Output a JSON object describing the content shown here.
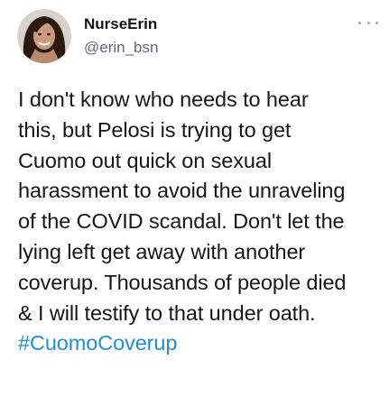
{
  "user": {
    "display_name": "NurseErin",
    "handle": "@erin_bsn"
  },
  "icons": {
    "more": "more-horizontal-icon"
  },
  "tweet": {
    "lines": [
      "I don't know who needs to hear",
      "this, but Pelosi is trying to get",
      "Cuomo out quick on sexual",
      "harassment to avoid the unraveling",
      "of the COVID scandal.  Don't let the",
      "lying left get away with another",
      "coverup. Thousands of people died",
      "& I will testify to that under oath."
    ],
    "hashtag": "#CuomoCoverup"
  },
  "colors": {
    "hashtag": "#1f8fd9",
    "handle": "#5f6a73",
    "text": "#161616"
  }
}
